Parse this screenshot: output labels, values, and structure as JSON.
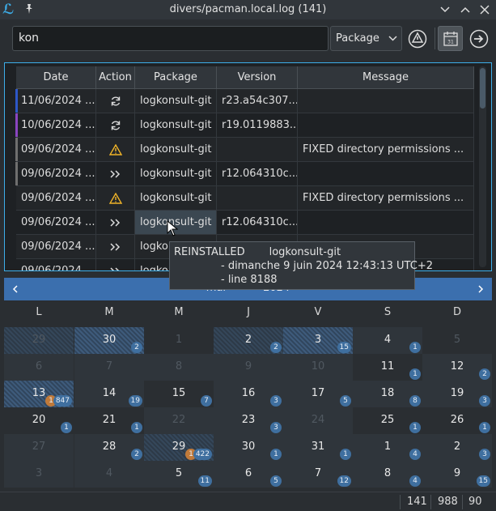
{
  "window": {
    "title": "divers/pacman.local.log (141)"
  },
  "toolbar": {
    "search_value": "kon",
    "filter_combo": "Package"
  },
  "table": {
    "headers": [
      "Date",
      "Action",
      "Package",
      "Version",
      "Message"
    ],
    "rows": [
      {
        "date": "11/06/2024 ...",
        "action": "upgrade-icon",
        "package": "logkonsult-git",
        "version": "r23.a54c307....",
        "message": "",
        "marker": "#2d57c7"
      },
      {
        "date": "10/06/2024 ...",
        "action": "upgrade-icon",
        "package": "logkonsult-git",
        "version": "r19.0119883....",
        "message": "",
        "marker": "#8a45c0"
      },
      {
        "date": "09/06/2024 ...",
        "action": "warning-icon",
        "package": "logkonsult-git",
        "version": "",
        "message": "FIXED directory permissions ...",
        "marker": "#6f6f6f"
      },
      {
        "date": "09/06/2024 ...",
        "action": "reinstall-icon",
        "package": "logkonsult-git",
        "version": "r12.064310c....",
        "message": "",
        "marker": "#6f6f6f"
      },
      {
        "date": "09/06/2024 ...",
        "action": "warning-icon",
        "package": "logkonsult-git",
        "version": "",
        "message": "FIXED directory permissions ...",
        "marker": ""
      },
      {
        "date": "09/06/2024 ...",
        "action": "reinstall-icon",
        "package": "logkonsult-git",
        "version": "r12.064310c....",
        "message": "",
        "marker": ""
      },
      {
        "date": "09/06/2024 ...",
        "action": "reinstall-icon",
        "package": "logko",
        "version": "",
        "message": "",
        "marker": ""
      },
      {
        "date": "09/06/2024 ...",
        "action": "reinstall-icon",
        "package": "logko",
        "version": "",
        "message": "",
        "marker": ""
      }
    ]
  },
  "tooltip": {
    "action": "REINSTALLED",
    "package": "logkonsult-git",
    "date_line": "- dimanche 9 juin 2024 12:43:13 UTC+2",
    "line_line": "- line 8188"
  },
  "calendar": {
    "month_label": "mai",
    "sep": "-",
    "year": "2024",
    "weekdays": [
      "L",
      "M",
      "M",
      "J",
      "V",
      "S",
      "D"
    ],
    "weeks": [
      [
        {
          "d": "29",
          "muted": true,
          "style": "hatch"
        },
        {
          "d": "30",
          "badge": "2",
          "style": "hatch-light"
        },
        {
          "d": "1",
          "muted": true,
          "style": "dark"
        },
        {
          "d": "2",
          "badge": "2",
          "style": "hatch"
        },
        {
          "d": "3",
          "badge": "15",
          "style": "hatch-light"
        },
        {
          "d": "4",
          "badge": "1",
          "style": "plain"
        },
        {
          "d": "5",
          "muted": true,
          "style": "dark"
        }
      ],
      [
        {
          "d": "6",
          "muted": true,
          "style": "plain"
        },
        {
          "d": "7",
          "muted": true,
          "style": "plain"
        },
        {
          "d": "8",
          "muted": true,
          "style": "plain"
        },
        {
          "d": "9",
          "muted": true,
          "style": "plain"
        },
        {
          "d": "10",
          "muted": true,
          "style": "plain"
        },
        {
          "d": "11",
          "badge": "1",
          "style": "dark"
        },
        {
          "d": "12",
          "badge": "2",
          "style": "plain"
        }
      ],
      [
        {
          "d": "13",
          "badge": "847",
          "obadge": "1",
          "style": "hatch-light"
        },
        {
          "d": "14",
          "badge": "19",
          "style": "plain"
        },
        {
          "d": "15",
          "badge": "7",
          "style": "dark"
        },
        {
          "d": "16",
          "badge": "3",
          "style": "plain"
        },
        {
          "d": "17",
          "badge": "5",
          "style": "plain"
        },
        {
          "d": "18",
          "badge": "8",
          "style": "plain"
        },
        {
          "d": "19",
          "badge": "3",
          "style": "plain"
        }
      ],
      [
        {
          "d": "20",
          "badge": "1",
          "style": "dark"
        },
        {
          "d": "21",
          "badge": "1",
          "style": "dark"
        },
        {
          "d": "22",
          "muted": true,
          "style": "plain"
        },
        {
          "d": "23",
          "badge": "3",
          "style": "plain"
        },
        {
          "d": "24",
          "muted": true,
          "style": "plain"
        },
        {
          "d": "25",
          "badge": "1",
          "style": "dark"
        },
        {
          "d": "26",
          "badge": "1",
          "style": "dark"
        }
      ],
      [
        {
          "d": "27",
          "muted": true,
          "style": "plain"
        },
        {
          "d": "28",
          "badge": "2",
          "style": "plain"
        },
        {
          "d": "29",
          "badge": "422",
          "obadge": "1",
          "style": "hatch"
        },
        {
          "d": "30",
          "badge": "1",
          "style": "plain"
        },
        {
          "d": "31",
          "badge": "1",
          "style": "plain"
        },
        {
          "d": "1",
          "badge": "4",
          "style": "plain"
        },
        {
          "d": "2",
          "badge": "3",
          "style": "plain"
        }
      ],
      [
        {
          "d": "3",
          "muted": true,
          "style": "plain"
        },
        {
          "d": "4",
          "muted": true,
          "style": "plain"
        },
        {
          "d": "5",
          "badge": "11",
          "style": "plain"
        },
        {
          "d": "6",
          "badge": "5",
          "style": "plain"
        },
        {
          "d": "7",
          "badge": "12",
          "style": "plain"
        },
        {
          "d": "8",
          "badge": "4",
          "style": "plain"
        },
        {
          "d": "9",
          "badge": "15",
          "style": "plain"
        }
      ]
    ]
  },
  "status": {
    "count": "141",
    "total": "988",
    "size": "90"
  },
  "colors": {
    "accent": "#3daee9",
    "calendar_header": "#3b6fae",
    "warning": "#f0b429",
    "badge": "#3f6f9f",
    "badge_orange": "#c07a3a"
  }
}
